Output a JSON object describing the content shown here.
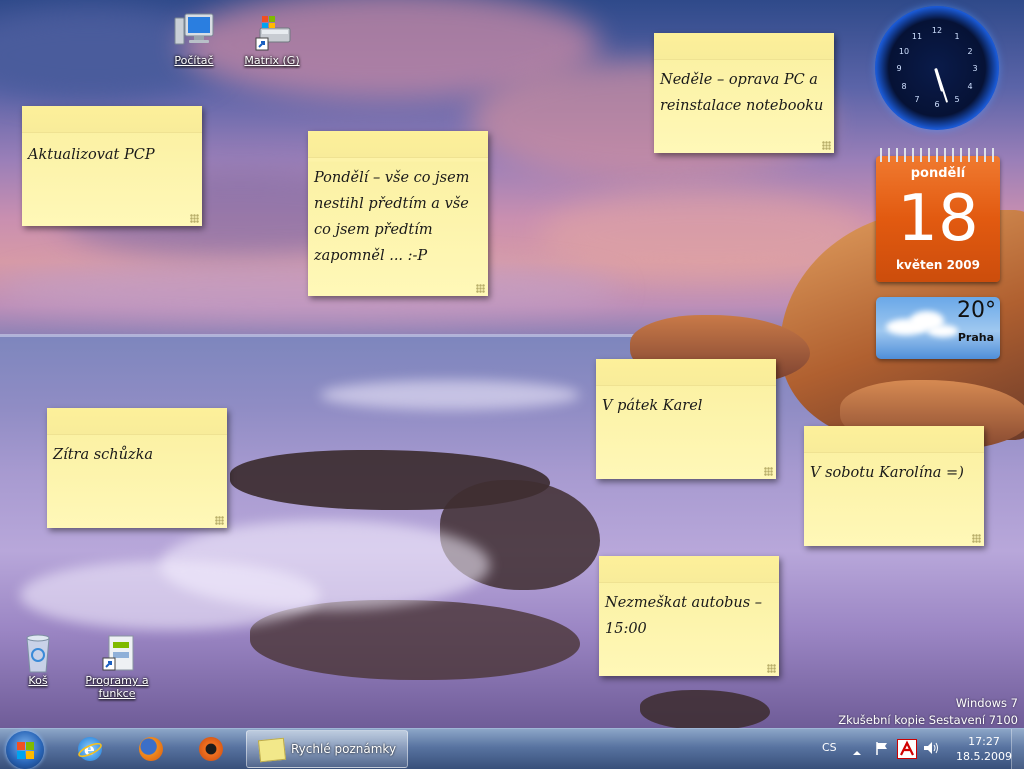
{
  "desktop": {
    "icons": [
      {
        "label": "Počítač"
      },
      {
        "label": "Matrix (G)"
      },
      {
        "label": "Koš"
      },
      {
        "label": "Programy a funkce"
      }
    ],
    "icon_names": [
      "computer-icon",
      "network-drive-icon",
      "recycle-bin-icon",
      "programs-features-icon"
    ]
  },
  "notes": [
    {
      "text": "Aktualizovat PCP"
    },
    {
      "text": "Pondělí – vše co jsem nestihl předtím a vše co jsem předtím zapomněl ... :-P"
    },
    {
      "text": "Neděle – oprava PC a reinstalace notebooku"
    },
    {
      "text": "Zítra schůzka"
    },
    {
      "text": "V pátek Karel"
    },
    {
      "text": "V sobotu Karolína =)"
    },
    {
      "text": "Nezmeškat autobus – 15:00"
    }
  ],
  "gadgets": {
    "clock": {
      "numbers": [
        "12",
        "1",
        "2",
        "3",
        "4",
        "5",
        "6",
        "7",
        "8",
        "9",
        "10",
        "11"
      ],
      "time": "17:27"
    },
    "calendar": {
      "day_name": "pondělí",
      "day": "18",
      "month_year": "květen 2009"
    },
    "weather": {
      "temperature": "20°",
      "city": "Praha"
    }
  },
  "watermark": {
    "line1": "Windows 7",
    "line2": "Zkušební kopie Sestavení 7100"
  },
  "taskbar": {
    "pinned": [
      "internet-explorer-icon",
      "firefox-icon",
      "reason-icon"
    ],
    "active_task": "Rychlé poznámky",
    "language": "CS",
    "time": "17:27",
    "date": "18.5.2009"
  },
  "colors": {
    "note_yellow": "#fff8b8",
    "calendar_orange": "#e25a10",
    "taskbar_blue": "#46649a"
  }
}
